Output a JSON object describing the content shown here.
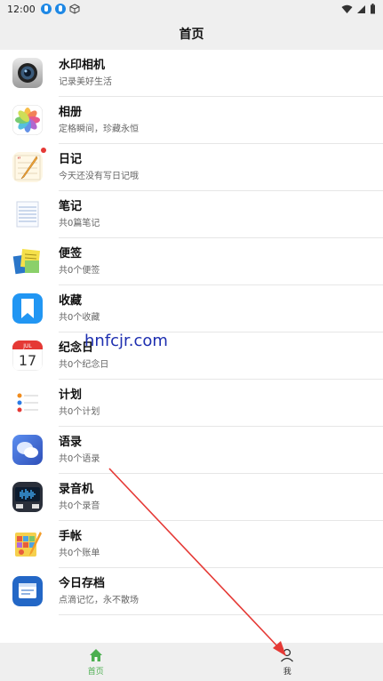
{
  "status_bar": {
    "time": "12:00"
  },
  "header": {
    "title": "首页"
  },
  "items": [
    {
      "title": "水印相机",
      "subtitle": "记录美好生活",
      "icon": "camera-icon"
    },
    {
      "title": "相册",
      "subtitle": "定格瞬间，珍藏永恒",
      "icon": "photos-icon"
    },
    {
      "title": "日记",
      "subtitle": "今天还没有写日记哦",
      "icon": "diary-icon"
    },
    {
      "title": "笔记",
      "subtitle": "共0篇笔记",
      "icon": "notes-icon"
    },
    {
      "title": "便签",
      "subtitle": "共0个便签",
      "icon": "sticky-notes-icon"
    },
    {
      "title": "收藏",
      "subtitle": "共0个收藏",
      "icon": "bookmark-icon"
    },
    {
      "title": "纪念日",
      "subtitle": "共0个纪念日",
      "icon": "calendar-icon"
    },
    {
      "title": "计划",
      "subtitle": "共0个计划",
      "icon": "reminders-icon"
    },
    {
      "title": "语录",
      "subtitle": "共0个语录",
      "icon": "chat-bubbles-icon"
    },
    {
      "title": "录音机",
      "subtitle": "共0个录音",
      "icon": "recorder-icon"
    },
    {
      "title": "手帐",
      "subtitle": "共0个账单",
      "icon": "ledger-icon"
    },
    {
      "title": "今日存档",
      "subtitle": "点滴记忆，永不散场",
      "icon": "archive-icon"
    }
  ],
  "calendar_icon": {
    "month": "JUL",
    "day": "17"
  },
  "watermark": "hnfcjr.com",
  "bottom_nav": [
    {
      "label": "首页",
      "icon": "home-icon",
      "active": true
    },
    {
      "label": "我",
      "icon": "person-icon",
      "active": false
    }
  ],
  "colors": {
    "active": "#4caf50",
    "accent_arrow": "#e53935"
  }
}
